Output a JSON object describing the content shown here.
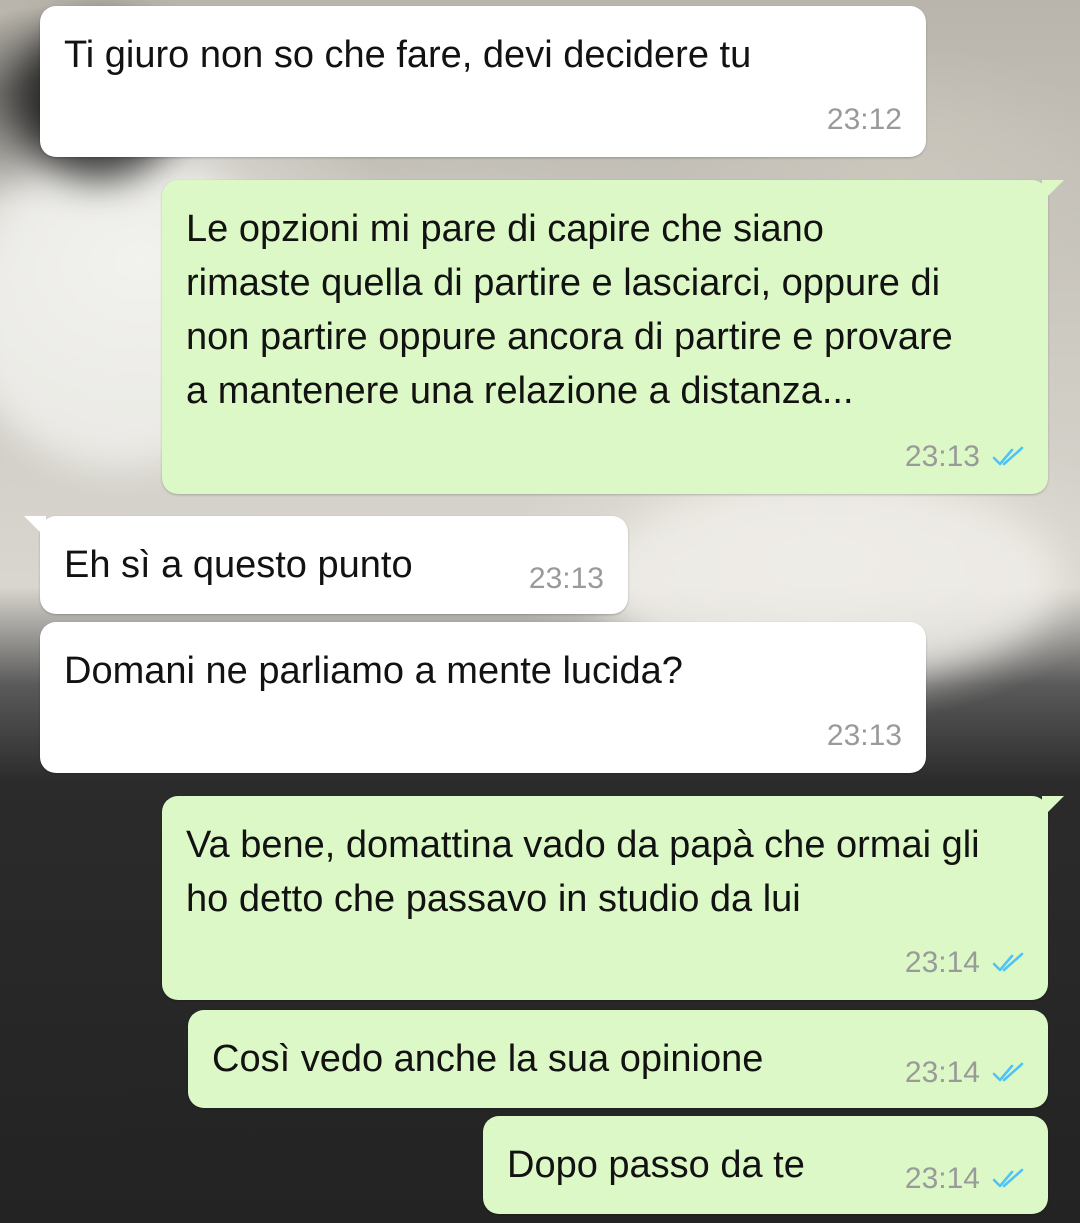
{
  "chat": {
    "messages": [
      {
        "direction": "in",
        "text": "Ti giuro non so che fare, devi decidere tu",
        "time": "23:12"
      },
      {
        "direction": "out",
        "text": "Le opzioni mi pare di capire che siano rimaste quella di partire e lasciarci, oppure di non partire oppure ancora di partire e provare a mantenere una relazione a distanza...",
        "time": "23:13",
        "status": "read"
      },
      {
        "direction": "in",
        "text": "Eh sì a questo punto",
        "time": "23:13"
      },
      {
        "direction": "in",
        "text": "Domani ne parliamo a mente lucida?",
        "time": "23:13"
      },
      {
        "direction": "out",
        "text": "Va bene, domattina vado da papà che ormai gli ho detto che passavo in studio da lui",
        "time": "23:14",
        "status": "read"
      },
      {
        "direction": "out",
        "text": "Così vedo anche la sua opinione",
        "time": "23:14",
        "status": "read"
      },
      {
        "direction": "out",
        "text": "Dopo passo da te",
        "time": "23:14",
        "status": "read"
      }
    ]
  },
  "colors": {
    "incoming_bubble": "#ffffff",
    "outgoing_bubble": "#dcf8c6",
    "read_ticks": "#4fc3f7",
    "timestamp": "#9a9a9a"
  },
  "icons": {
    "read_receipt": "double-check-icon"
  }
}
